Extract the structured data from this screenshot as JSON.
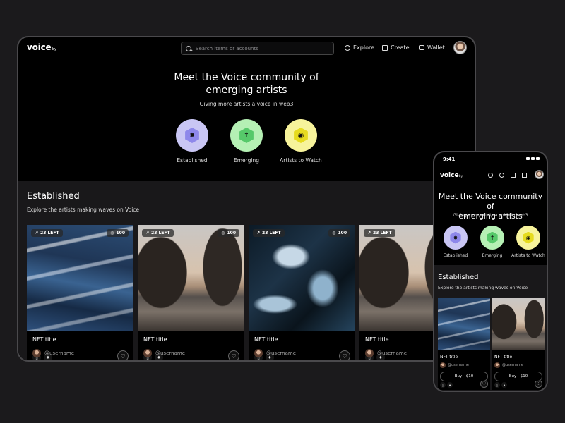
{
  "nav": {
    "logo": "voice",
    "logo_suffix": "by",
    "search_placeholder": "Search items or accounts",
    "links": [
      "Explore",
      "Create",
      "Wallet"
    ]
  },
  "hero": {
    "title_line1": "Meet the Voice community of",
    "title_line2": "emerging artists",
    "subtitle": "Giving more artists a voice in web3",
    "categories": [
      {
        "label": "Established",
        "circle": "#c9c6f4",
        "hex": "#8e88ea",
        "icon": "star-burst-icon",
        "glyph": "✸"
      },
      {
        "label": "Emerging",
        "circle": "#b5f0b4",
        "hex": "#56c96a",
        "icon": "arrow-up-icon",
        "glyph": "↑"
      },
      {
        "label": "Artists to Watch",
        "circle": "#f7f39b",
        "hex": "#e6db1f",
        "icon": "eye-icon",
        "glyph": "◉"
      }
    ]
  },
  "established": {
    "title": "Established",
    "subtitle": "Explore the artists making waves on Voice",
    "cards": [
      {
        "left": "23 LEFT",
        "count": "100",
        "title": "NFT title",
        "user": "@username",
        "image": "img-sea"
      },
      {
        "left": "23 LEFT",
        "count": "100",
        "title": "NFT title",
        "user": "@username",
        "image": "img-rock"
      },
      {
        "left": "23 LEFT",
        "count": "100",
        "title": "NFT title",
        "user": "@username",
        "image": "img-marble"
      },
      {
        "left": "23 LEFT",
        "count": "",
        "title": "NFT title",
        "user": "@username",
        "image": "img-rock"
      }
    ]
  },
  "phone": {
    "time": "9:41",
    "cards": [
      {
        "title": "NFT title",
        "user": "@username",
        "buy": "Buy - $10",
        "image": "img-sea"
      },
      {
        "title": "NFT title",
        "user": "@username",
        "buy": "Buy - $10",
        "image": "img-rock"
      }
    ]
  }
}
